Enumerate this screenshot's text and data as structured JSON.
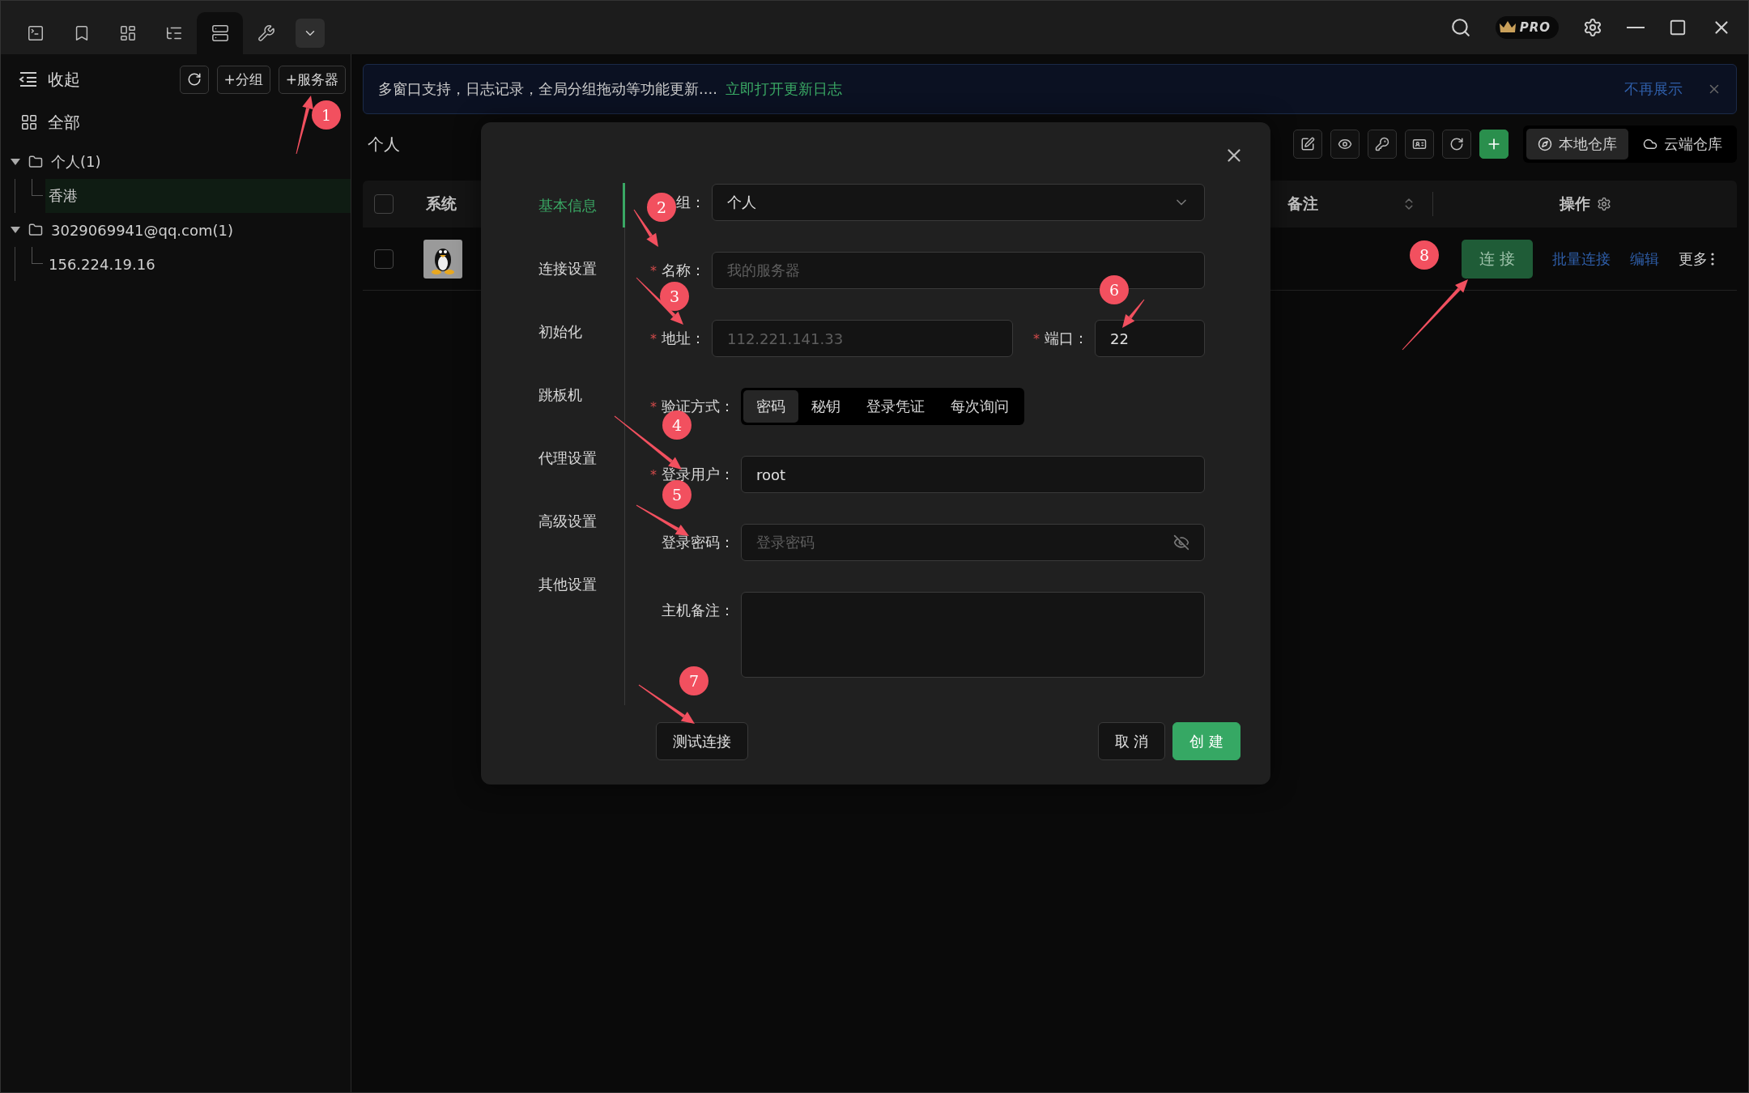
{
  "title_bar": {
    "tabs": [
      {
        "kind": "terminal",
        "selected": false
      },
      {
        "kind": "bookmark",
        "selected": false
      },
      {
        "kind": "panels",
        "selected": false
      },
      {
        "kind": "tree",
        "selected": false
      },
      {
        "kind": "server",
        "selected": true
      },
      {
        "kind": "wrench",
        "selected": false
      }
    ],
    "pro_badge": "PRO"
  },
  "sidebar": {
    "collapse": "收起",
    "buttons": [
      "+分组",
      "+服务器"
    ],
    "all": "全部",
    "tree": [
      {
        "label": "个人(1)",
        "expanded": true,
        "children": [
          {
            "label": "香港",
            "selected": true
          }
        ]
      },
      {
        "label": "3029069941@qq.com(1)",
        "expanded": true,
        "children": [
          {
            "label": "156.224.19.16",
            "selected": false
          }
        ]
      }
    ]
  },
  "banner": {
    "message": "多窗口支持，日志记录，全局分组拖动等功能更新....",
    "link": "立即打开更新日志",
    "dismiss": "不再展示"
  },
  "group_title": "个人",
  "repo_tabs": [
    {
      "label": "本地仓库",
      "selected": true
    },
    {
      "label": "云端仓库",
      "selected": false
    }
  ],
  "table": {
    "columns": [
      "系统",
      "备注",
      "操作"
    ],
    "header_checked": false,
    "rows": [
      {
        "checked": false,
        "connect": "连 接",
        "links": [
          "批量连接",
          "编辑"
        ],
        "more": "更多"
      }
    ]
  },
  "dialog": {
    "nav": [
      {
        "label": "基本信息",
        "selected": true
      },
      {
        "label": "连接设置",
        "selected": false
      },
      {
        "label": "初始化",
        "selected": false
      },
      {
        "label": "跳板机",
        "selected": false
      },
      {
        "label": "代理设置",
        "selected": false
      },
      {
        "label": "高级设置",
        "selected": false
      },
      {
        "label": "其他设置",
        "selected": false
      }
    ],
    "fields": [
      {
        "kind": "select",
        "label": "组：",
        "value": "个人"
      },
      {
        "kind": "text",
        "label": "名称：",
        "required_mark": "*",
        "placeholder": "我的服务器"
      },
      {
        "kind": "address",
        "label": "地址：",
        "required_mark": "*",
        "placeholder": "112.221.141.33",
        "port_label": "端口：",
        "port_required_mark": "*",
        "port_value": "22"
      },
      {
        "kind": "segmented",
        "label": "验证方式：",
        "required_mark": "*",
        "options": [
          {
            "label": "密码",
            "selected": true
          },
          {
            "label": "秘钥",
            "selected": false
          },
          {
            "label": "登录凭证",
            "selected": false
          },
          {
            "label": "每次询问",
            "selected": false
          }
        ]
      },
      {
        "kind": "text",
        "label": "登录用户：",
        "required_mark": "*",
        "value": "root"
      },
      {
        "kind": "password",
        "label": "登录密码：",
        "placeholder": "登录密码"
      },
      {
        "kind": "textarea",
        "label": "主机备注："
      }
    ],
    "test_button": "测试连接",
    "cancel_button": "取 消",
    "create_button": "创 建"
  },
  "annotations": [
    "1",
    "2",
    "3",
    "4",
    "5",
    "6",
    "7",
    "8"
  ]
}
